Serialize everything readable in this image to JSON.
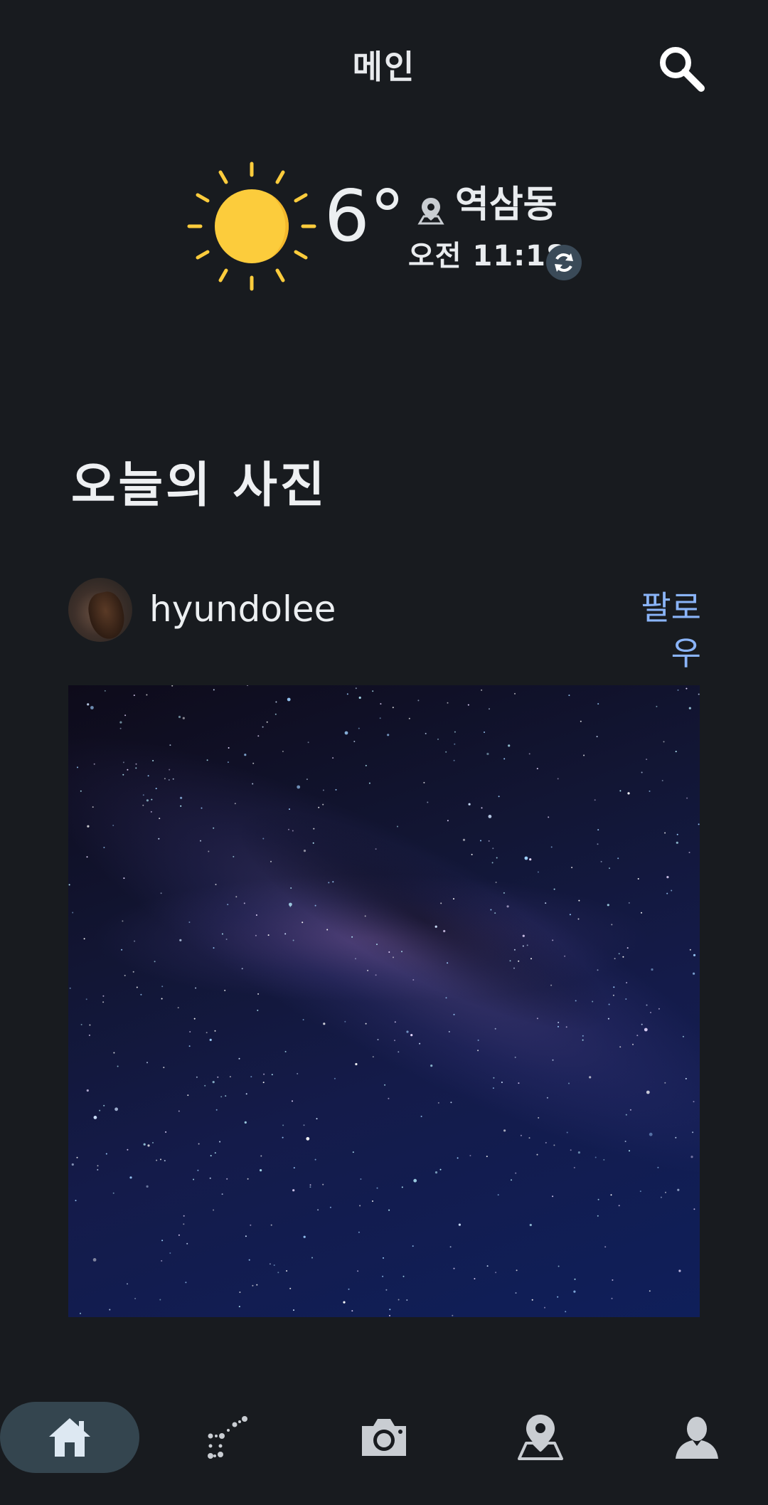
{
  "header": {
    "title": "메인",
    "search_icon": "search-icon"
  },
  "weather": {
    "icon": "sun-icon",
    "temperature": "6°",
    "location_icon": "location-pin-icon",
    "location": "역삼동",
    "time": "오전 11:18",
    "refresh_icon": "refresh-icon",
    "refresh_color": "#3a4a58"
  },
  "section": {
    "title": "오늘의 사진"
  },
  "post": {
    "username": "hyundolee",
    "follow_label": "팔로우",
    "follow_color": "#8ab4f8"
  },
  "nav": {
    "items": [
      {
        "icon": "home-icon",
        "active": true
      },
      {
        "icon": "constellation-icon",
        "active": false
      },
      {
        "icon": "camera-icon",
        "active": false
      },
      {
        "icon": "map-pin-icon",
        "active": false
      },
      {
        "icon": "profile-icon",
        "active": false
      }
    ],
    "active_bg": "#34454f"
  },
  "colors": {
    "background": "#181b1f",
    "sun": "#fccc3c"
  }
}
